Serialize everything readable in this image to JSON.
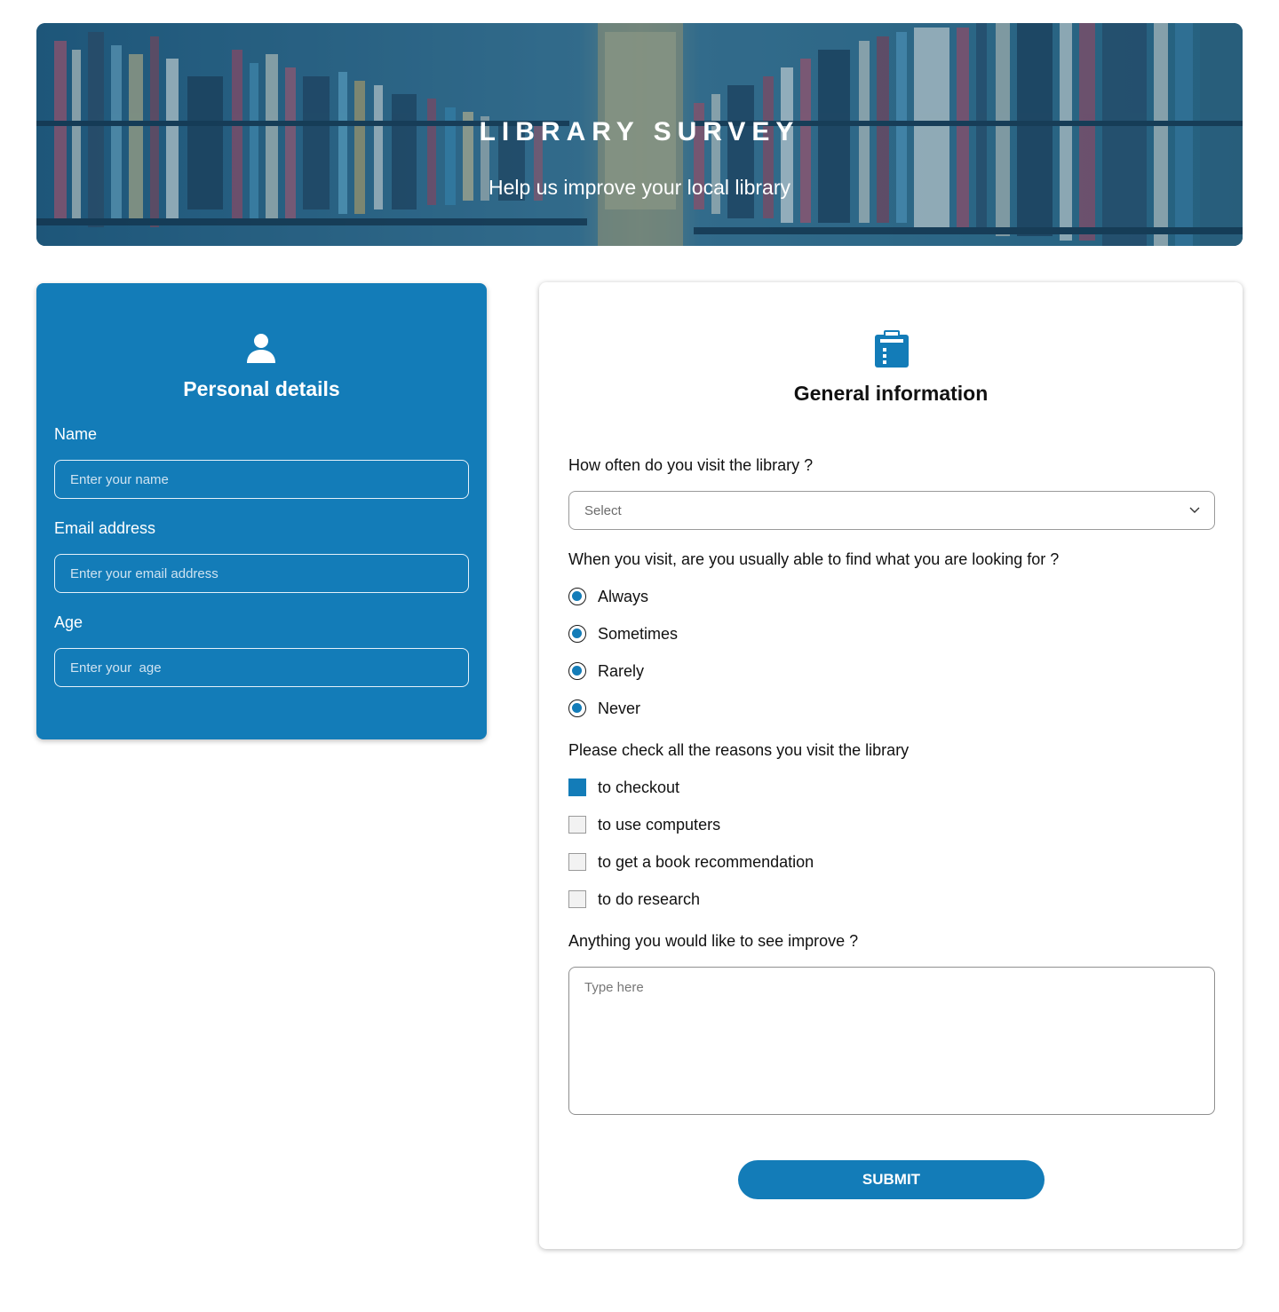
{
  "hero": {
    "title": "LIBRARY SURVEY",
    "subtitle": "Help us improve your local library",
    "image": "library-bookshelves-photo"
  },
  "personal": {
    "icon": "person-icon",
    "title": "Personal details",
    "fields": [
      {
        "label": "Name",
        "placeholder": "Enter your name"
      },
      {
        "label": "Email address",
        "placeholder": "Enter your email address"
      },
      {
        "label": "Age",
        "placeholder": "Enter your  age"
      }
    ]
  },
  "general": {
    "icon": "clipboard-icon",
    "title": "General information",
    "q_frequency": {
      "label": "How often do you visit the library ?",
      "selected": "Select"
    },
    "q_find": {
      "label": "When you visit, are you usually able to find what you are looking for ?",
      "options": [
        "Always",
        "Sometimes",
        "Rarely",
        "Never"
      ]
    },
    "q_reasons": {
      "label": "Please check all the reasons you visit the library",
      "options": [
        {
          "text": "to checkout",
          "checked": true
        },
        {
          "text": "to use computers",
          "checked": false
        },
        {
          "text": "to get a book recommendation",
          "checked": false
        },
        {
          "text": "to do research",
          "checked": false
        }
      ]
    },
    "q_improve": {
      "label": "Anything you would like to see improve ?",
      "placeholder": "Type here"
    },
    "submit_label": "SUBMIT"
  },
  "colors": {
    "accent": "#137cb8",
    "white": "#ffffff",
    "text": "#111111"
  }
}
